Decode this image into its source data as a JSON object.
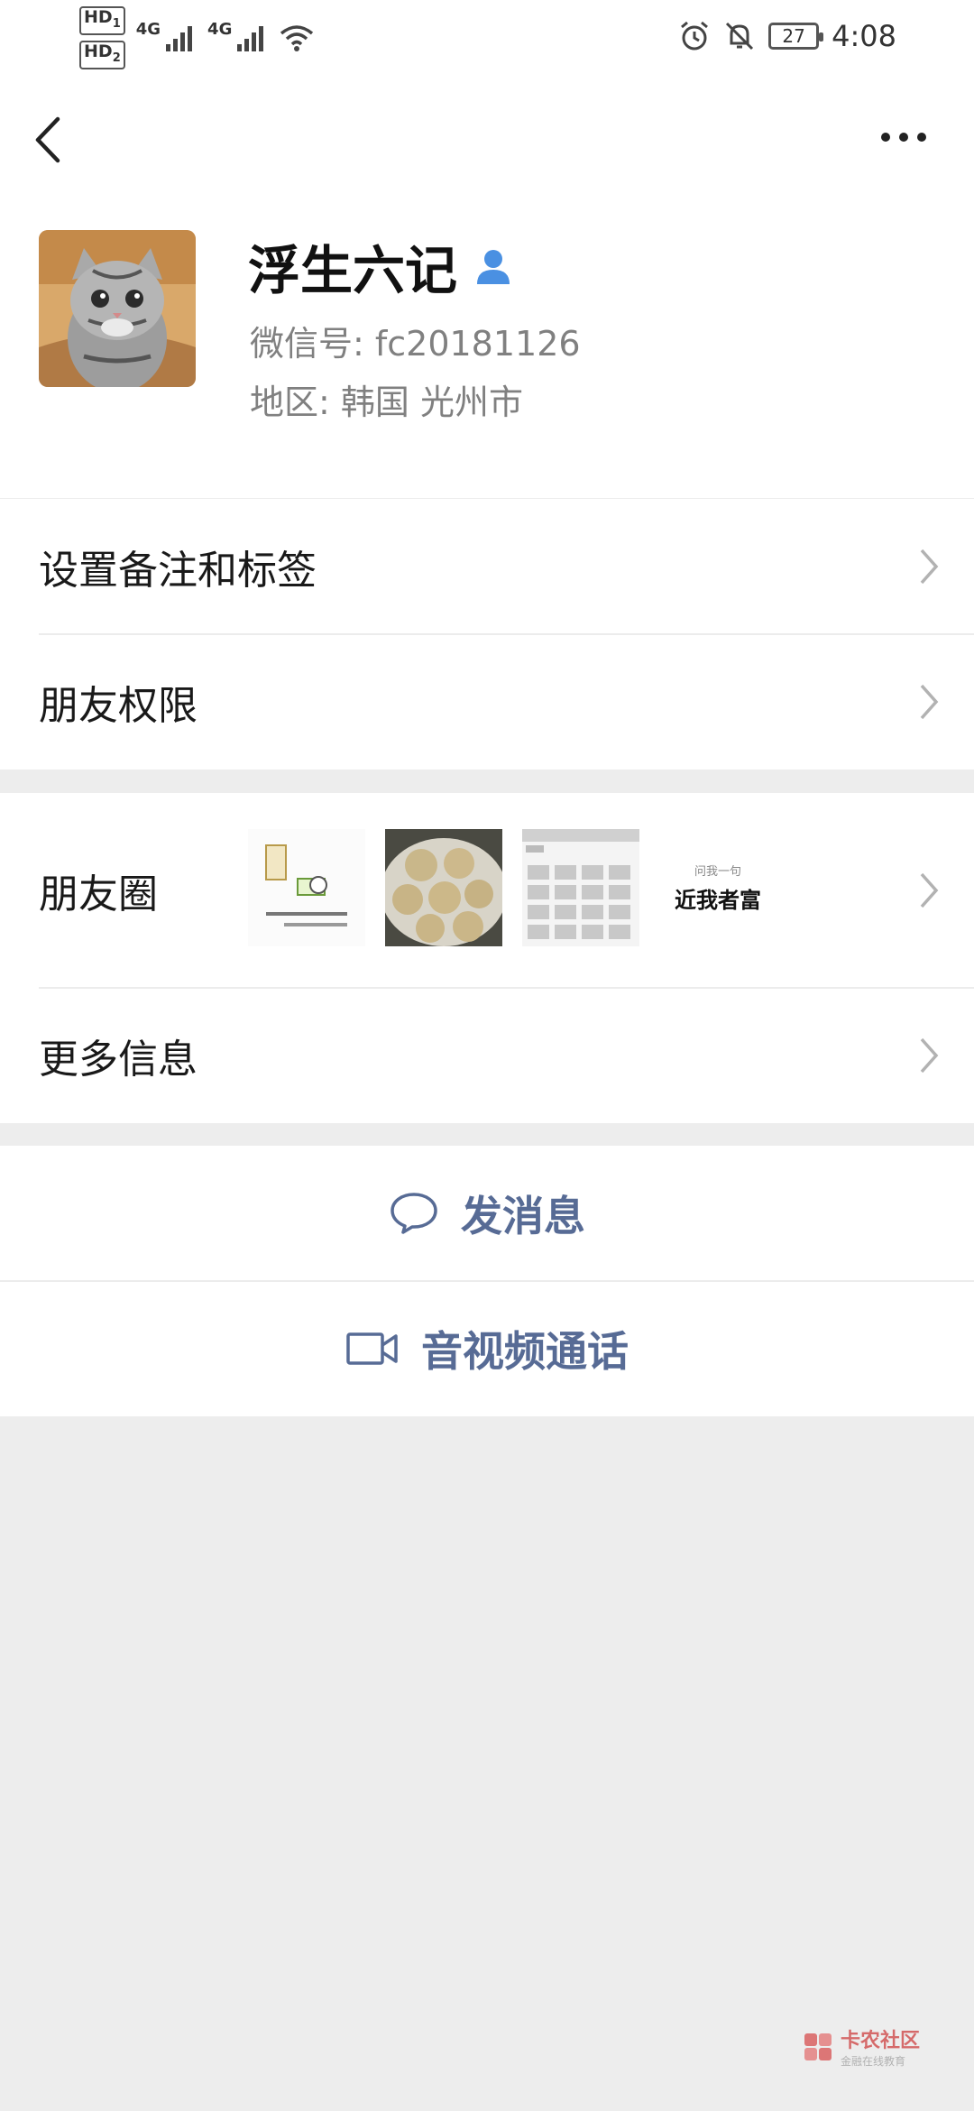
{
  "status_bar": {
    "hd1": "HD",
    "hd1_sub": "1",
    "hd2": "HD",
    "hd2_sub": "2",
    "net1": "4G",
    "net2": "4G",
    "battery": "27",
    "time": "4:08"
  },
  "profile": {
    "name": "浮生六记",
    "wechat_id": "微信号: fc20181126",
    "region": "地区: 韩国  光州市"
  },
  "menu": {
    "remarks_tags": "设置备注和标签",
    "friend_permissions": "朋友权限",
    "moments": "朋友圈",
    "more_info": "更多信息"
  },
  "moments_thumbs": {
    "thumb4_small": "问我一句",
    "thumb4_big": "近我者富"
  },
  "actions": {
    "send_message": "发消息",
    "video_call": "音视频通话"
  },
  "watermark": {
    "main": "卡农社区",
    "sub": "金融在线教育"
  },
  "colors": {
    "accent": "#576b95",
    "background": "#ededed",
    "user_icon": "#4a90e2"
  }
}
